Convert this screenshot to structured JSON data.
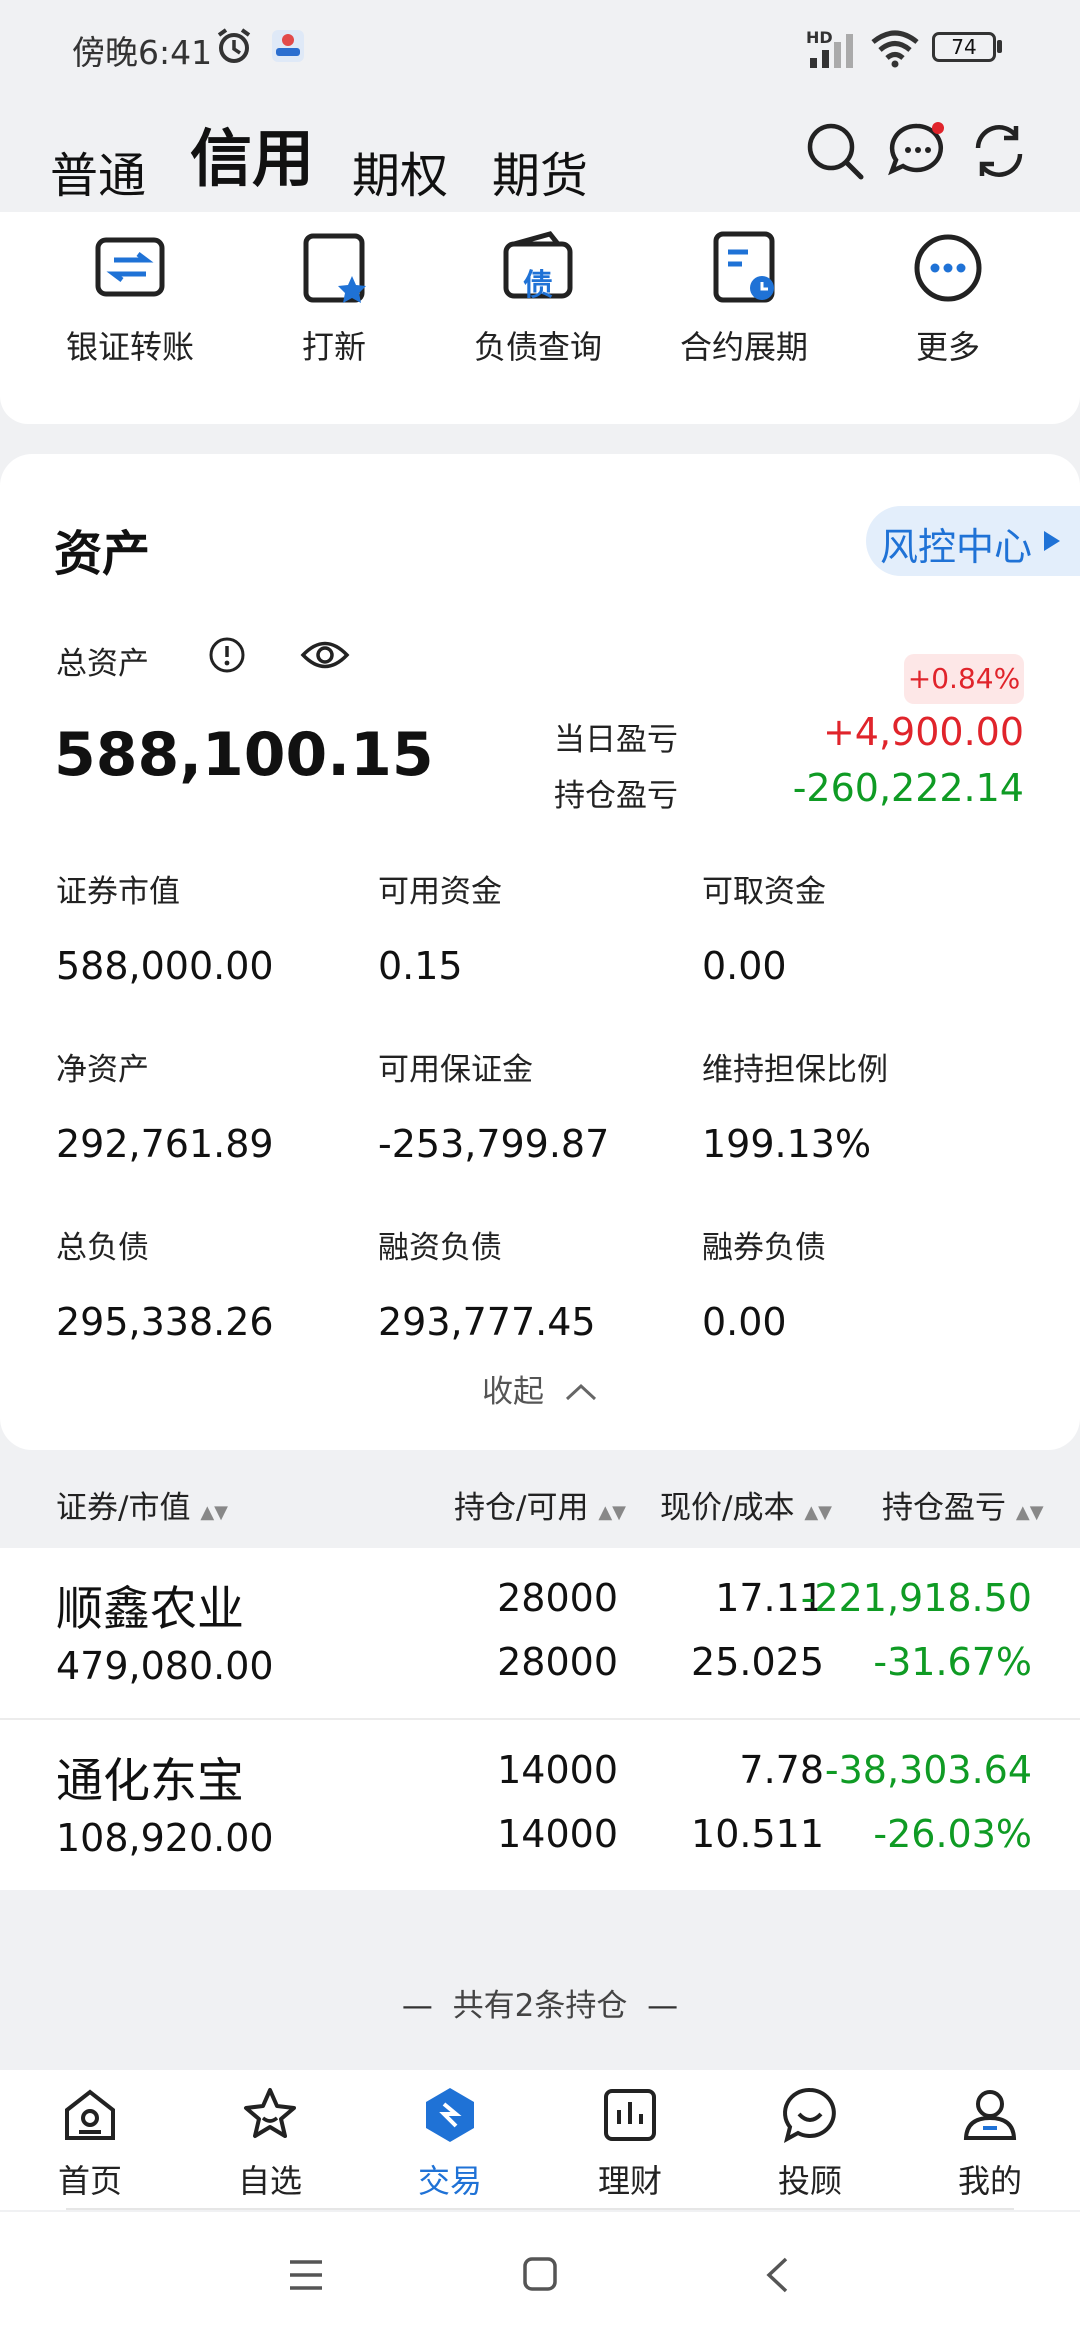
{
  "status": {
    "time": "傍晚6:41",
    "battery": "74",
    "hd": "HD"
  },
  "header": {
    "tabs": [
      {
        "label": "普通"
      },
      {
        "label": "信用"
      },
      {
        "label": "期权"
      },
      {
        "label": "期货"
      }
    ]
  },
  "quick_actions": [
    {
      "label": "银证转账",
      "icon": "transfer-icon"
    },
    {
      "label": "打新",
      "icon": "new-shares-icon"
    },
    {
      "label": "负债查询",
      "icon": "debt-query-icon"
    },
    {
      "label": "合约展期",
      "icon": "contract-extend-icon"
    },
    {
      "label": "更多",
      "icon": "more-icon"
    }
  ],
  "debt_icon_char": "债",
  "assets": {
    "title": "资产",
    "risk_center": "风控中心",
    "total_label": "总资产",
    "total_value": "588,100.15",
    "daily_pct": "+0.84%",
    "daily_pl_label": "当日盈亏",
    "daily_pl_value": "+4,900.00",
    "hold_pl_label": "持仓盈亏",
    "hold_pl_value": "-260,222.14",
    "grid": [
      {
        "label": "证券市值",
        "value": "588,000.00"
      },
      {
        "label": "可用资金",
        "value": "0.15"
      },
      {
        "label": "可取资金",
        "value": "0.00"
      },
      {
        "label": "净资产",
        "value": "292,761.89"
      },
      {
        "label": "可用保证金",
        "value": "-253,799.87"
      },
      {
        "label": "维持担保比例",
        "value": "199.13%"
      },
      {
        "label": "总负债",
        "value": "295,338.26"
      },
      {
        "label": "融资负债",
        "value": "293,777.45"
      },
      {
        "label": "融券负债",
        "value": "0.00"
      }
    ],
    "collapse_label": "收起"
  },
  "positions": {
    "headers": [
      "证券/市值",
      "持仓/可用",
      "现价/成本",
      "持仓盈亏"
    ],
    "rows": [
      {
        "name": "顺鑫农业",
        "market_value": "479,080.00",
        "hold": "28000",
        "avail": "28000",
        "price": "17.11",
        "cost": "25.025",
        "pl": "-221,918.50",
        "pl_pct": "-31.67%"
      },
      {
        "name": "通化东宝",
        "market_value": "108,920.00",
        "hold": "14000",
        "avail": "14000",
        "price": "7.78",
        "cost": "10.511",
        "pl": "-38,303.64",
        "pl_pct": "-26.03%"
      }
    ],
    "count_text": "共有2条持仓"
  },
  "bottom_nav": [
    {
      "label": "首页",
      "icon": "home-icon"
    },
    {
      "label": "自选",
      "icon": "star-icon"
    },
    {
      "label": "交易",
      "icon": "trade-icon"
    },
    {
      "label": "理财",
      "icon": "finance-icon"
    },
    {
      "label": "投顾",
      "icon": "advisor-icon"
    },
    {
      "label": "我的",
      "icon": "profile-icon"
    }
  ],
  "colors": {
    "accent": "#1f72d6",
    "up": "#e0242b",
    "down": "#0f9b24"
  }
}
